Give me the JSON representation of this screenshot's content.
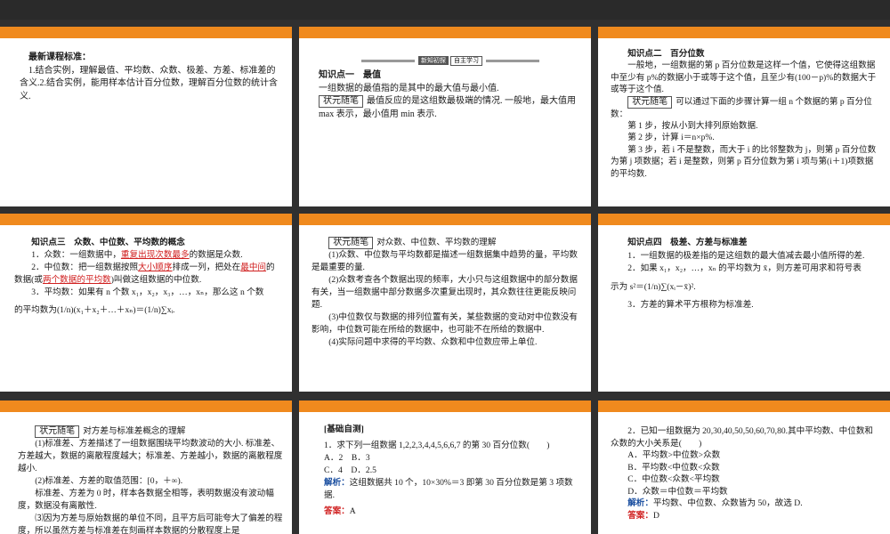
{
  "s1": {
    "title": "最新课程标准：",
    "text": "1.结合实例，理解最值、平均数、众数、极差、方差、标准差的含义.2.结合实例，能用样本估计百分位数，理解百分位数的统计含义."
  },
  "s2": {
    "badge_a": "新知初探",
    "badge_b": "自主学习",
    "heading": "知识点一　最值",
    "line1": "一组数据的最值指的是其中的最大值与最小值.",
    "tag": "状元随笔",
    "line2": "最值反应的是这组数最极端的情况. 一般地，最大值用 max 表示，最小值用 min 表示."
  },
  "s3": {
    "heading": "知识点二　百分位数",
    "p1": "一般地，一组数据的第 p 百分位数是这样一个值，它使得这组数据中至少有 p%的数据小于或等于这个值，且至少有(100－p)%的数据大于或等于这个值.",
    "tag": "状元随笔",
    "p2": "可以通过下面的步骤计算一组 n 个数据的第 p 百分位数：",
    "step1": "第 1 步，按从小到大排列原始数据.",
    "step2": "第 2 步，计算 i＝n×p%.",
    "step3": "第 3 步，若 i 不是整数，而大于 i 的比邻整数为 j，则第 p 百分位数为第 j 项数据；若 i 是整数，则第 p 百分位数为第 i 项与第(i＋1)项数据的平均数."
  },
  "s4": {
    "heading": "知识点三　众数、中位数、平均数的概念",
    "i1a": "1．众数：一组数据中，",
    "i1b": "重复出现次数最多",
    "i1c": "的数据是众数.",
    "i2a": "2．中位数：把一组数据按照",
    "i2b": "大小顺序",
    "i2c": "排成一列，把处在",
    "i2d": "最中间",
    "i2e": "的数据(或",
    "i2f": "两个数据的平均数",
    "i2g": ")叫做这组数据的中位数.",
    "i3a": "3．平均数：如果有 n 个数 x₁，x₂，x₃，…，xₙ，那么这 n 个数",
    "i3b": "的平均数为(1/n)(x₁＋x₂＋…＋xₙ)＝(1/n)∑xᵢ."
  },
  "s5": {
    "tag": "状元随笔",
    "title": "对众数、中位数、平均数的理解",
    "p1": "(1)众数、中位数与平均数都是描述一组数据集中趋势的量，平均数是最重要的量.",
    "p2": "(2)众数考查各个数据出现的频率，大小只与这组数据中的部分数据有关，当一组数据中部分数据多次重复出现时，其众数往往更能反映问题.",
    "p3": "(3)中位数仅与数据的排列位置有关，某些数据的变动对中位数没有影响，中位数可能在所给的数据中，也可能不在所给的数据中.",
    "p4": "(4)实际问题中求得的平均数、众数和中位数应带上单位."
  },
  "s6": {
    "heading": "知识点四　极差、方差与标准差",
    "p1": "1．一组数据的极差指的是这组数的最大值减去最小值所得的差.",
    "p2": "2．如果 x₁，x₂，…，xₙ 的平均数为 x̄，则方差可用求和符号表",
    "p3": "示为 s²＝(1/n)∑(xᵢ－x̄)².",
    "p4": "3．方差的算术平方根称为标准差."
  },
  "s7": {
    "tag": "状元随笔",
    "title": "对方差与标准差概念的理解",
    "p1": "(1)标准差、方差描述了一组数据围绕平均数波动的大小. 标准差、方差越大，数据的离散程度越大；标准差、方差越小，数据的离散程度越小.",
    "p2": "(2)标准差、方差的取值范围：[0，＋∞).",
    "p3": "标准差、方差为 0 时，样本各数据全相等，表明数据没有波动幅度，数据没有离散性.",
    "p4": "⑶因为方差与原始数据的单位不同，且平方后可能夸大了偏差的程度，所以虽然方差与标准差在刻画样本数据的分散程度上是"
  },
  "s8": {
    "title": "[基础自测]",
    "q": "1．求下列一组数据 1,2,2,3,4,4,5,6,6,7 的第 30 百分位数(　　)",
    "opts1": "A．2　B．3",
    "opts2": "C．4　D．2.5",
    "jx_label": "解析：",
    "jx": "这组数据共 10 个，10×30%＝3 即第 30 百分位数是第 3 项数据.",
    "ans_label": "答案：",
    "ans": "A"
  },
  "s9": {
    "q": "2．已知一组数据为 20,30,40,50,50,60,70,80.其中平均数、中位数和众数的大小关系是(　　)",
    "a": "A．平均数>中位数>众数",
    "b": "B．平均数<中位数<众数",
    "c": "C．中位数<众数<平均数",
    "d": "D．众数＝中位数＝平均数",
    "jx_label": "解析：",
    "jx": "平均数、中位数、众数皆为 50，故选 D.",
    "ans_label": "答案：",
    "ans": "D"
  }
}
